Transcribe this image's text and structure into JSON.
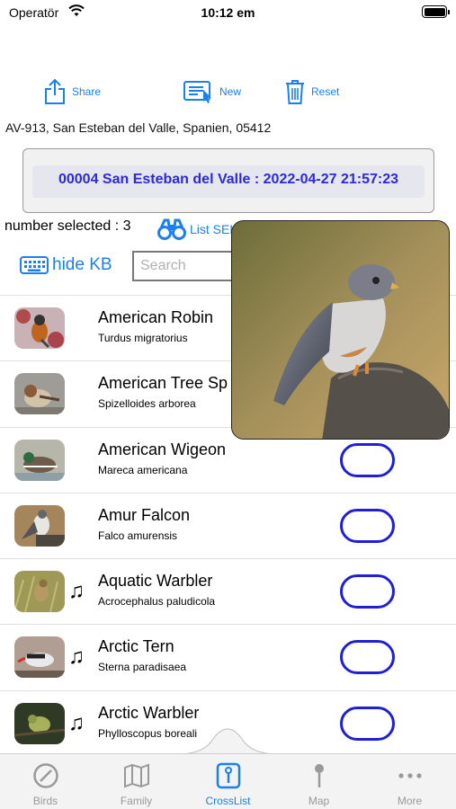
{
  "status_bar": {
    "carrier": "Operatör",
    "time": "10:12 em"
  },
  "toolbar": {
    "share_label": "Share",
    "new_label": "New",
    "reset_label": "Reset"
  },
  "address": "AV-913, San Esteban del Valle, Spanien, 05412",
  "session": "00004 San Esteban del Valle : 2022-04-27 21:57:23",
  "selection": {
    "count_text": "number selected : 3",
    "list_selected_label": "List SEL"
  },
  "keyboard": {
    "hide_label": "hide KB",
    "search_placeholder": "Search"
  },
  "birds": [
    {
      "common": "American Robin",
      "scientific": "Turdus migratorius",
      "has_sound": false,
      "toggle_visible": false
    },
    {
      "common": "American Tree Sp",
      "scientific": "Spizelloides arborea",
      "has_sound": false,
      "toggle_visible": false
    },
    {
      "common": "American Wigeon",
      "scientific": "Mareca americana",
      "has_sound": false,
      "toggle_visible": true
    },
    {
      "common": "Amur Falcon",
      "scientific": "Falco amurensis",
      "has_sound": false,
      "toggle_visible": true
    },
    {
      "common": "Aquatic Warbler",
      "scientific": "Acrocephalus paludicola",
      "has_sound": true,
      "toggle_visible": true
    },
    {
      "common": "Arctic Tern",
      "scientific": "Sterna paradisaea",
      "has_sound": true,
      "toggle_visible": true
    },
    {
      "common": "Arctic Warbler",
      "scientific": "Phylloscopus boreali",
      "has_sound": true,
      "toggle_visible": true
    }
  ],
  "sound_icon": "♫",
  "tabs": [
    {
      "label": "Birds",
      "icon": "compass-icon",
      "active": false
    },
    {
      "label": "Family",
      "icon": "map-book-icon",
      "active": false
    },
    {
      "label": "CrossList",
      "icon": "crosslist-icon",
      "active": true
    },
    {
      "label": "Map",
      "icon": "pin-icon",
      "active": false
    },
    {
      "label": "More",
      "icon": "more-icon",
      "active": false
    }
  ],
  "colors": {
    "accent": "#1a7ff0",
    "session_text": "#2a2adb",
    "toggle_border": "#1f1fd6"
  }
}
